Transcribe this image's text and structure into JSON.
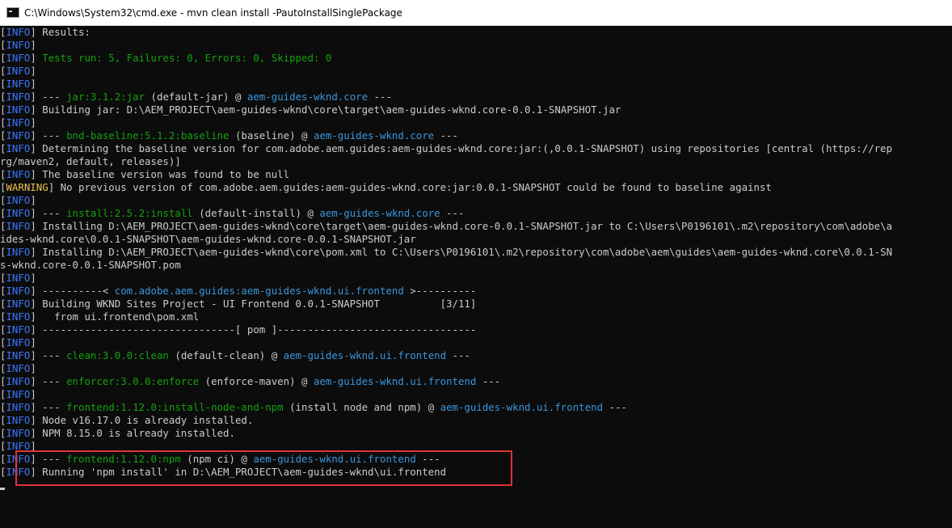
{
  "window": {
    "title": "C:\\Windows\\System32\\cmd.exe - mvn  clean install -PautoInstallSinglePackage",
    "icon": "cmd-icon"
  },
  "colors": {
    "background": "#0c0c0c",
    "text": "#cccccc",
    "info": "#3b78ff",
    "warning": "#e8c44c",
    "green": "#13a10e",
    "cyan": "#3a96dd",
    "highlight": "#e0333a"
  },
  "console": {
    "lines": [
      [
        {
          "t": "[",
          "c": "tag-bracket"
        },
        {
          "t": "INFO",
          "c": "lvl-info"
        },
        {
          "t": "] Results:",
          "c": ""
        }
      ],
      [
        {
          "t": "[",
          "c": "tag-bracket"
        },
        {
          "t": "INFO",
          "c": "lvl-info"
        },
        {
          "t": "]",
          "c": ""
        }
      ],
      [
        {
          "t": "[",
          "c": "tag-bracket"
        },
        {
          "t": "INFO",
          "c": "lvl-info"
        },
        {
          "t": "] ",
          "c": ""
        },
        {
          "t": "Tests run: 5, Failures: 0, Errors: 0, Skipped: 0",
          "c": "green"
        }
      ],
      [
        {
          "t": "[",
          "c": "tag-bracket"
        },
        {
          "t": "INFO",
          "c": "lvl-info"
        },
        {
          "t": "]",
          "c": ""
        }
      ],
      [
        {
          "t": "[",
          "c": "tag-bracket"
        },
        {
          "t": "INFO",
          "c": "lvl-info"
        },
        {
          "t": "]",
          "c": ""
        }
      ],
      [
        {
          "t": "[",
          "c": "tag-bracket"
        },
        {
          "t": "INFO",
          "c": "lvl-info"
        },
        {
          "t": "] --- ",
          "c": ""
        },
        {
          "t": "jar:3.1.2:jar",
          "c": "dgreen"
        },
        {
          "t": " (default-jar) @ ",
          "c": ""
        },
        {
          "t": "aem-guides-wknd.core",
          "c": "cyan"
        },
        {
          "t": " ---",
          "c": ""
        }
      ],
      [
        {
          "t": "[",
          "c": "tag-bracket"
        },
        {
          "t": "INFO",
          "c": "lvl-info"
        },
        {
          "t": "] Building jar: D:\\AEM_PROJECT\\aem-guides-wknd\\core\\target\\aem-guides-wknd.core-0.0.1-SNAPSHOT.jar",
          "c": ""
        }
      ],
      [
        {
          "t": "[",
          "c": "tag-bracket"
        },
        {
          "t": "INFO",
          "c": "lvl-info"
        },
        {
          "t": "]",
          "c": ""
        }
      ],
      [
        {
          "t": "[",
          "c": "tag-bracket"
        },
        {
          "t": "INFO",
          "c": "lvl-info"
        },
        {
          "t": "] --- ",
          "c": ""
        },
        {
          "t": "bnd-baseline:5.1.2:baseline",
          "c": "dgreen"
        },
        {
          "t": " (baseline) @ ",
          "c": ""
        },
        {
          "t": "aem-guides-wknd.core",
          "c": "cyan"
        },
        {
          "t": " ---",
          "c": ""
        }
      ],
      [
        {
          "t": "[",
          "c": "tag-bracket"
        },
        {
          "t": "INFO",
          "c": "lvl-info"
        },
        {
          "t": "] Determining the baseline version for com.adobe.aem.guides:aem-guides-wknd.core:jar:(,0.0.1-SNAPSHOT) using repositories [central (https://rep",
          "c": ""
        }
      ],
      [
        {
          "t": "rg/maven2, default, releases)]",
          "c": ""
        }
      ],
      [
        {
          "t": "[",
          "c": "tag-bracket"
        },
        {
          "t": "INFO",
          "c": "lvl-info"
        },
        {
          "t": "] The baseline version was found to be null",
          "c": ""
        }
      ],
      [
        {
          "t": "[",
          "c": "tag-bracket"
        },
        {
          "t": "WARNING",
          "c": "lvl-warn"
        },
        {
          "t": "] No previous version of com.adobe.aem.guides:aem-guides-wknd.core:jar:0.0.1-SNAPSHOT could be found to baseline against",
          "c": ""
        }
      ],
      [
        {
          "t": "[",
          "c": "tag-bracket"
        },
        {
          "t": "INFO",
          "c": "lvl-info"
        },
        {
          "t": "]",
          "c": ""
        }
      ],
      [
        {
          "t": "[",
          "c": "tag-bracket"
        },
        {
          "t": "INFO",
          "c": "lvl-info"
        },
        {
          "t": "] --- ",
          "c": ""
        },
        {
          "t": "install:2.5.2:install",
          "c": "dgreen"
        },
        {
          "t": " (default-install) @ ",
          "c": ""
        },
        {
          "t": "aem-guides-wknd.core",
          "c": "cyan"
        },
        {
          "t": " ---",
          "c": ""
        }
      ],
      [
        {
          "t": "[",
          "c": "tag-bracket"
        },
        {
          "t": "INFO",
          "c": "lvl-info"
        },
        {
          "t": "] Installing D:\\AEM_PROJECT\\aem-guides-wknd\\core\\target\\aem-guides-wknd.core-0.0.1-SNAPSHOT.jar to C:\\Users\\P0196101\\.m2\\repository\\com\\adobe\\a",
          "c": ""
        }
      ],
      [
        {
          "t": "ides-wknd.core\\0.0.1-SNAPSHOT\\aem-guides-wknd.core-0.0.1-SNAPSHOT.jar",
          "c": ""
        }
      ],
      [
        {
          "t": "[",
          "c": "tag-bracket"
        },
        {
          "t": "INFO",
          "c": "lvl-info"
        },
        {
          "t": "] Installing D:\\AEM_PROJECT\\aem-guides-wknd\\core\\pom.xml to C:\\Users\\P0196101\\.m2\\repository\\com\\adobe\\aem\\guides\\aem-guides-wknd.core\\0.0.1-SN",
          "c": ""
        }
      ],
      [
        {
          "t": "s-wknd.core-0.0.1-SNAPSHOT.pom",
          "c": ""
        }
      ],
      [
        {
          "t": "[",
          "c": "tag-bracket"
        },
        {
          "t": "INFO",
          "c": "lvl-info"
        },
        {
          "t": "]",
          "c": ""
        }
      ],
      [
        {
          "t": "[",
          "c": "tag-bracket"
        },
        {
          "t": "INFO",
          "c": "lvl-info"
        },
        {
          "t": "] ----------< ",
          "c": ""
        },
        {
          "t": "com.adobe.aem.guides:aem-guides-wknd.ui.frontend",
          "c": "cyan"
        },
        {
          "t": " >----------",
          "c": ""
        }
      ],
      [
        {
          "t": "[",
          "c": "tag-bracket"
        },
        {
          "t": "INFO",
          "c": "lvl-info"
        },
        {
          "t": "] Building WKND Sites Project - UI Frontend 0.0.1-SNAPSHOT          [3/11]",
          "c": ""
        }
      ],
      [
        {
          "t": "[",
          "c": "tag-bracket"
        },
        {
          "t": "INFO",
          "c": "lvl-info"
        },
        {
          "t": "]   from ui.frontend\\pom.xml",
          "c": ""
        }
      ],
      [
        {
          "t": "[",
          "c": "tag-bracket"
        },
        {
          "t": "INFO",
          "c": "lvl-info"
        },
        {
          "t": "] --------------------------------[ pom ]---------------------------------",
          "c": ""
        }
      ],
      [
        {
          "t": "[",
          "c": "tag-bracket"
        },
        {
          "t": "INFO",
          "c": "lvl-info"
        },
        {
          "t": "]",
          "c": ""
        }
      ],
      [
        {
          "t": "[",
          "c": "tag-bracket"
        },
        {
          "t": "INFO",
          "c": "lvl-info"
        },
        {
          "t": "] --- ",
          "c": ""
        },
        {
          "t": "clean:3.0.0:clean",
          "c": "dgreen"
        },
        {
          "t": " (default-clean) @ ",
          "c": ""
        },
        {
          "t": "aem-guides-wknd.ui.frontend",
          "c": "cyan"
        },
        {
          "t": " ---",
          "c": ""
        }
      ],
      [
        {
          "t": "[",
          "c": "tag-bracket"
        },
        {
          "t": "INFO",
          "c": "lvl-info"
        },
        {
          "t": "]",
          "c": ""
        }
      ],
      [
        {
          "t": "[",
          "c": "tag-bracket"
        },
        {
          "t": "INFO",
          "c": "lvl-info"
        },
        {
          "t": "] --- ",
          "c": ""
        },
        {
          "t": "enforcer:3.0.0:enforce",
          "c": "dgreen"
        },
        {
          "t": " (enforce-maven) @ ",
          "c": ""
        },
        {
          "t": "aem-guides-wknd.ui.frontend",
          "c": "cyan"
        },
        {
          "t": " ---",
          "c": ""
        }
      ],
      [
        {
          "t": "[",
          "c": "tag-bracket"
        },
        {
          "t": "INFO",
          "c": "lvl-info"
        },
        {
          "t": "]",
          "c": ""
        }
      ],
      [
        {
          "t": "[",
          "c": "tag-bracket"
        },
        {
          "t": "INFO",
          "c": "lvl-info"
        },
        {
          "t": "] --- ",
          "c": ""
        },
        {
          "t": "frontend:1.12.0:install-node-and-npm",
          "c": "dgreen"
        },
        {
          "t": " (install node and npm) @ ",
          "c": ""
        },
        {
          "t": "aem-guides-wknd.ui.frontend",
          "c": "cyan"
        },
        {
          "t": " ---",
          "c": ""
        }
      ],
      [
        {
          "t": "[",
          "c": "tag-bracket"
        },
        {
          "t": "INFO",
          "c": "lvl-info"
        },
        {
          "t": "] Node v16.17.0 is already installed.",
          "c": ""
        }
      ],
      [
        {
          "t": "[",
          "c": "tag-bracket"
        },
        {
          "t": "INFO",
          "c": "lvl-info"
        },
        {
          "t": "] NPM 8.15.0 is already installed.",
          "c": ""
        }
      ],
      [
        {
          "t": "[",
          "c": "tag-bracket"
        },
        {
          "t": "INFO",
          "c": "lvl-info"
        },
        {
          "t": "]",
          "c": ""
        }
      ],
      [
        {
          "t": "[",
          "c": "tag-bracket"
        },
        {
          "t": "INFO",
          "c": "lvl-info"
        },
        {
          "t": "] --- ",
          "c": ""
        },
        {
          "t": "frontend:1.12.0:npm",
          "c": "dgreen"
        },
        {
          "t": " (npm ci) @ ",
          "c": ""
        },
        {
          "t": "aem-guides-wknd.ui.frontend",
          "c": "cyan"
        },
        {
          "t": " ---",
          "c": ""
        }
      ],
      [
        {
          "t": "[",
          "c": "tag-bracket"
        },
        {
          "t": "INFO",
          "c": "lvl-info"
        },
        {
          "t": "] Running 'npm install' in D:\\AEM_PROJECT\\aem-guides-wknd\\ui.frontend",
          "c": ""
        }
      ]
    ]
  }
}
